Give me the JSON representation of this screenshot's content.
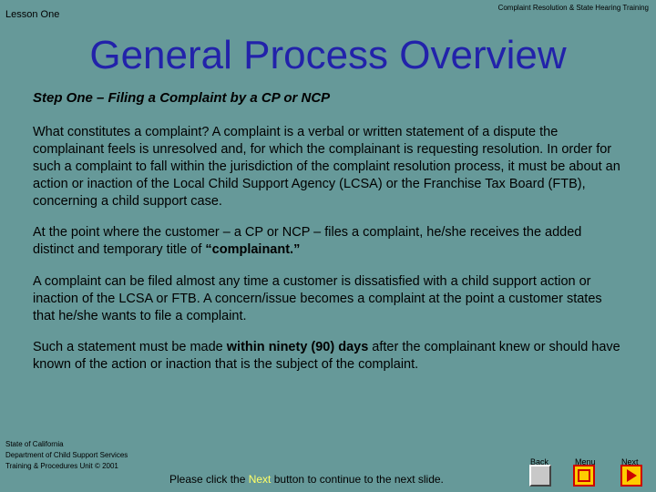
{
  "header": {
    "lesson": "Lesson One",
    "course": "Complaint Resolution & State Hearing Training"
  },
  "title": "General Process Overview",
  "step_heading": "Step One – Filing a Complaint by a CP or NCP",
  "paragraphs": {
    "p1": "What constitutes a complaint? A complaint is a verbal or written statement of a dispute the complainant feels is unresolved and, for which the complainant is requesting resolution. In order for such a complaint to fall within the jurisdiction of the complaint resolution process, it must be about an action or inaction of the Local Child Support Agency (LCSA) or the Franchise Tax Board (FTB), concerning a child support case.",
    "p2_a": "At the point where the customer – a CP or NCP – files a complaint, he/she receives the added distinct and temporary title of ",
    "p2_b": "“complainant.”",
    "p3": "A complaint can be filed almost any time a customer is dissatisfied with a child support action or inaction of the LCSA or FTB. A concern/issue becomes a complaint at the point a customer states that he/she wants to file a complaint.",
    "p4_a": "Such a statement must be made ",
    "p4_b": "within ninety (90) days",
    "p4_c": " after the complainant knew or should have known of the action or inaction that is the subject of the complaint."
  },
  "footer": {
    "line1": "State of California",
    "line2": "Department of Child Support Services",
    "line3": "Training & Procedures Unit © 2001",
    "msg_a": "Please click the ",
    "msg_next": "Next",
    "msg_b": " button to continue to the next slide."
  },
  "nav": {
    "back": "Back",
    "menu": "Menu",
    "next": "Next"
  },
  "colors": {
    "background": "#669999",
    "title": "#2222aa",
    "highlight": "#ffff66",
    "button_face": "#ffcc00",
    "button_border": "#cc0000"
  }
}
